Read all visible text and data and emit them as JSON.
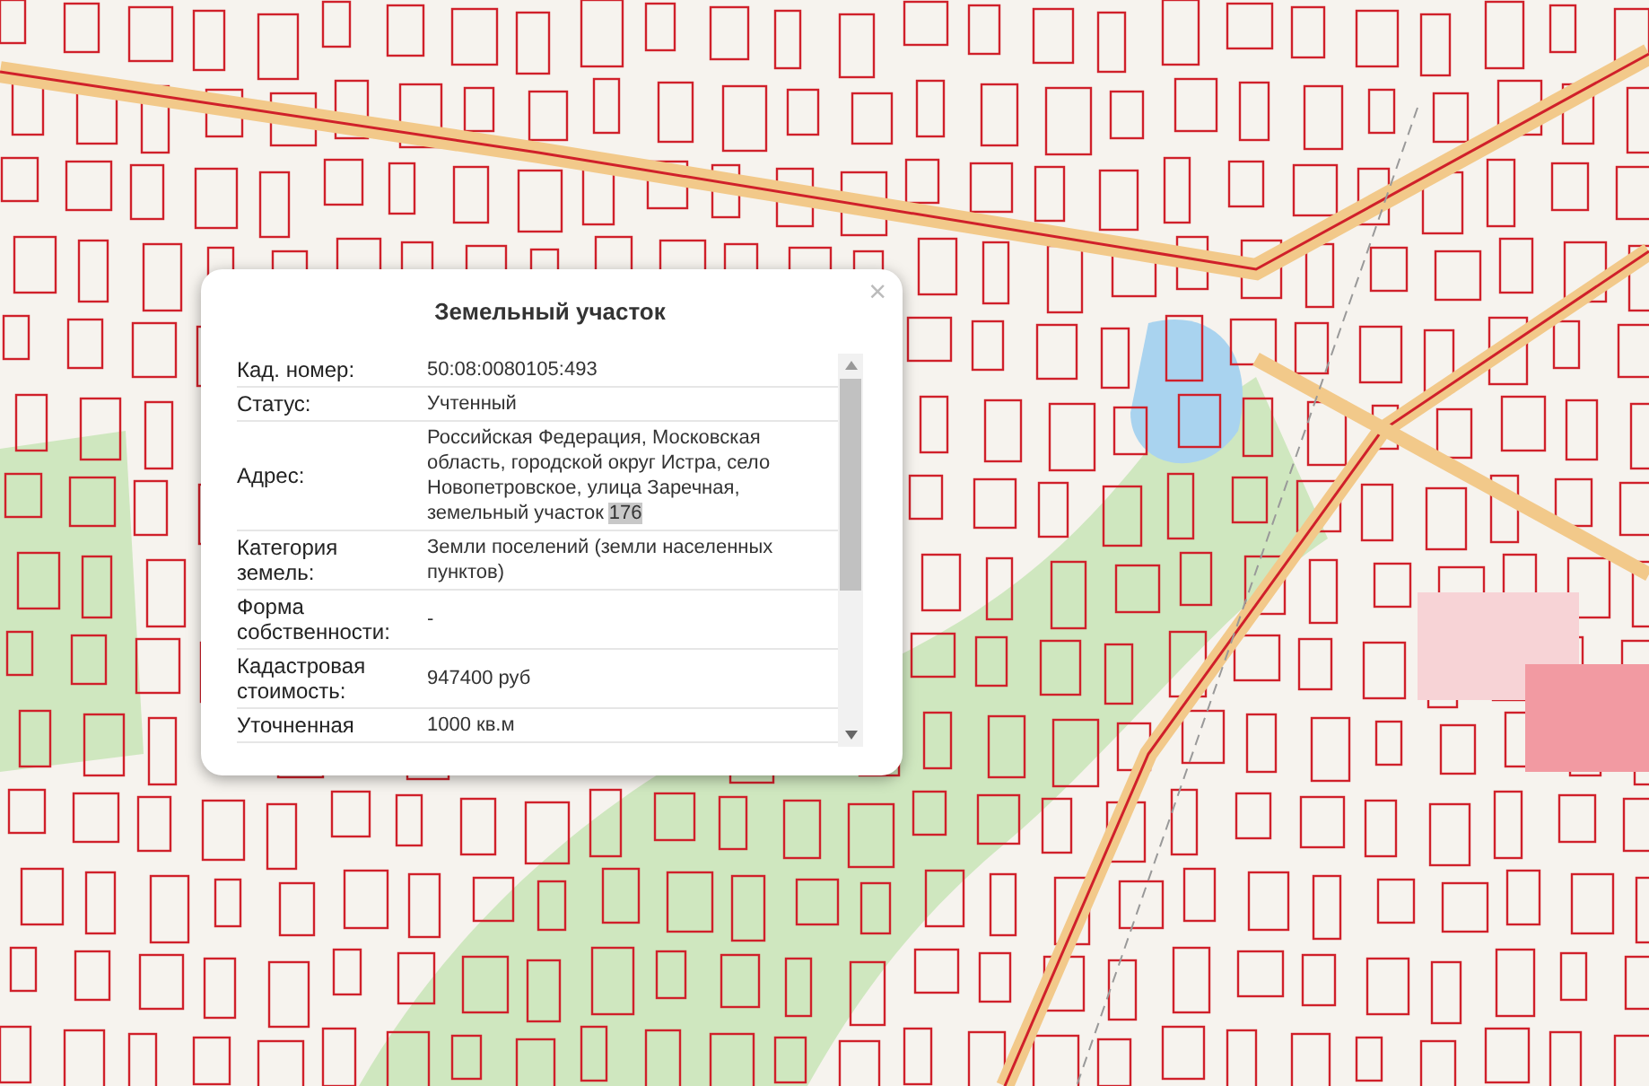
{
  "popup": {
    "title": "Земельный участок",
    "close": "×",
    "rows": [
      {
        "label": "Кад. номер:",
        "value": "50:08:0080105:493"
      },
      {
        "label": "Статус:",
        "value": "Учтенный"
      },
      {
        "label": "Адрес:",
        "value": "Российская Федерация, Московская область, городской округ Истра, село Новопетровское, улица Заречная, земельный участок",
        "highlight": "176"
      },
      {
        "label": "Категория земель:",
        "value": "Земли поселений (земли населенных пунктов)"
      },
      {
        "label": "Форма собственности:",
        "value": "-"
      },
      {
        "label": "Кадастровая стоимость:",
        "value": "947400 руб"
      },
      {
        "label": "Уточненная",
        "value": "1000 кв.м"
      }
    ]
  }
}
